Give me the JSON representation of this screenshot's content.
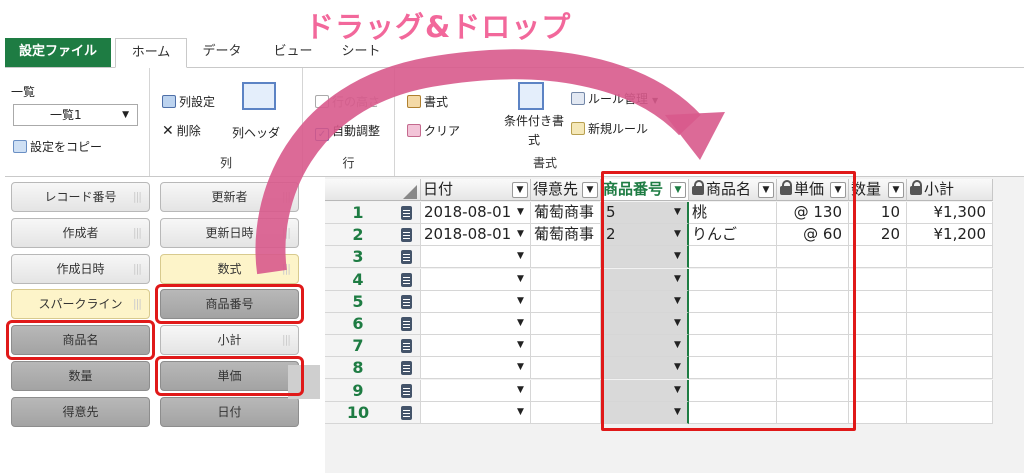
{
  "annotation": {
    "title": "ドラッグ&ドロップ",
    "accent": "#f2689b",
    "highlight": "#e01919"
  },
  "tabs": [
    "設定ファイル",
    "ホーム",
    "データ",
    "ビュー",
    "シート"
  ],
  "ribbon": {
    "list_label": "一覧",
    "list_value": "一覧1",
    "copy_settings": "設定をコピー",
    "col_settings": "列設定",
    "delete": "削除",
    "col_header": "列ヘッダ",
    "group_col": "列",
    "row_height": "行の高さ",
    "auto_adjust": "自動調整",
    "group_row": "行",
    "format": "書式",
    "clear": "クリア",
    "cond_format": "条件付き書式",
    "rules": "ルール管理",
    "new_rule": "新規ルール",
    "group_format": "書式"
  },
  "fields": [
    "レコード番号",
    "更新者",
    "作成者",
    "更新日時",
    "作成日時",
    "数式",
    "スパークライン",
    "商品番号",
    "商品名",
    "小計",
    "数量",
    "単価",
    "得意先",
    "日付"
  ],
  "grid": {
    "headers": [
      "日付",
      "得意先",
      "商品番号",
      "商品名",
      "単価",
      "数量",
      "小計"
    ],
    "row_numbers": [
      "1",
      "2",
      "3",
      "4",
      "5",
      "6",
      "7",
      "8",
      "9",
      "10"
    ],
    "rows": [
      {
        "date": "2018-08-01",
        "customer": "葡萄商事",
        "product_no": "5",
        "product_name": "桃",
        "price": "@ 130",
        "qty": "10",
        "subtotal": "¥1,300"
      },
      {
        "date": "2018-08-01",
        "customer": "葡萄商事",
        "product_no": "2",
        "product_name": "りんご",
        "price": "@ 60",
        "qty": "20",
        "subtotal": "¥1,200"
      }
    ]
  }
}
